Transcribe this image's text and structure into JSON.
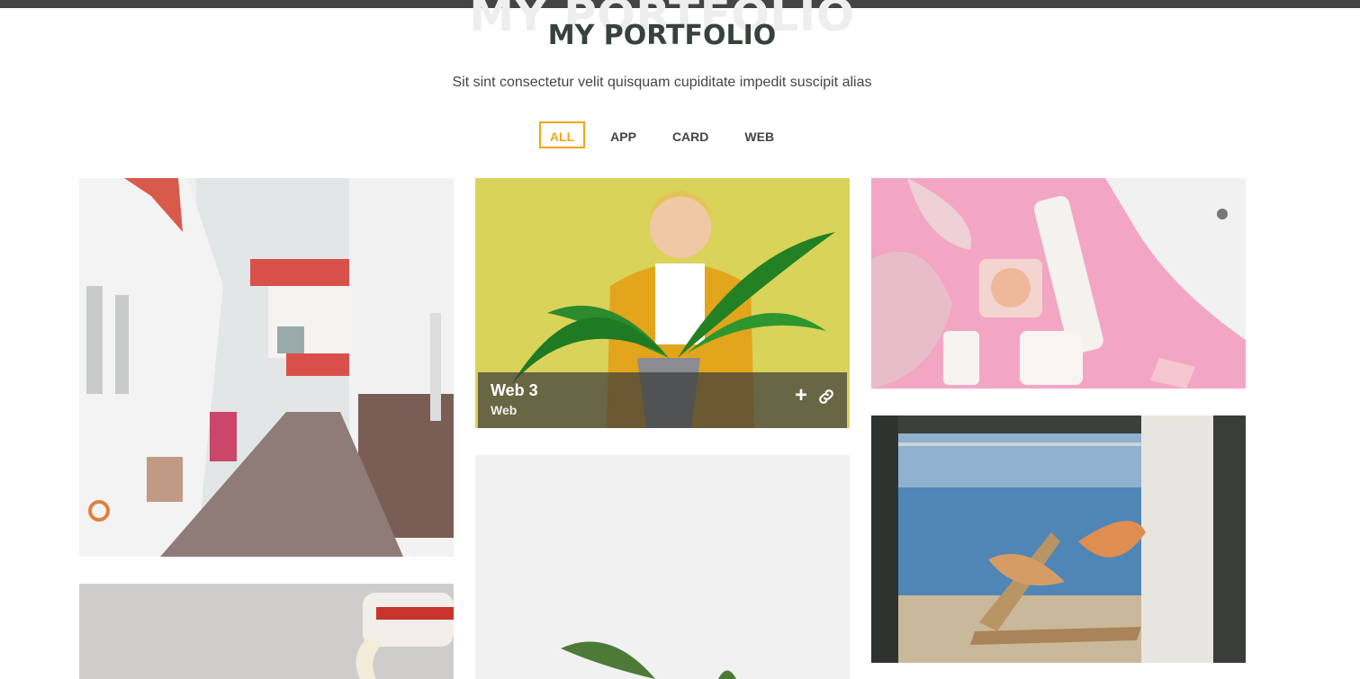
{
  "section": {
    "bg_title": "MY PORTFOLIO",
    "title": "MY PORTFOLIO",
    "subtitle": "Sit sint consectetur velit quisquam cupiditate impedit suscipit alias"
  },
  "filters": [
    {
      "label": "ALL",
      "active": true
    },
    {
      "label": "APP",
      "active": false
    },
    {
      "label": "CARD",
      "active": false
    },
    {
      "label": "WEB",
      "active": false
    }
  ],
  "hover_item": {
    "name": "Web 3",
    "category": "Web",
    "plus_icon": "plus-icon",
    "link_icon": "link-icon"
  },
  "colors": {
    "accent": "#f3a518",
    "heading": "#37423b",
    "overlay": "rgba(60,60,60,0.72)"
  }
}
